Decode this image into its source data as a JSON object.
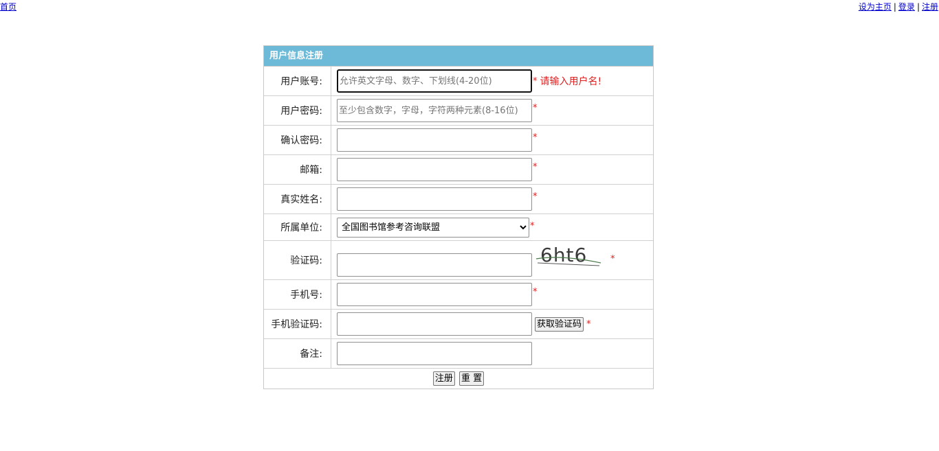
{
  "topbar": {
    "home_link": "首页",
    "set_homepage_link": "设为主页",
    "login_link": "登录",
    "register_link": "注册",
    "separator": "|"
  },
  "form": {
    "title": "用户信息注册",
    "required_mark": "*",
    "fields": {
      "username": {
        "label": "用户账号:",
        "placeholder": "允许英文字母、数字、下划线(4-20位)",
        "value": "",
        "error": "请输入用户名!"
      },
      "password": {
        "label": "用户密码:",
        "placeholder": "至少包含数字，字母，字符两种元素(8-16位)",
        "value": ""
      },
      "confirm_password": {
        "label": "确认密码:",
        "value": ""
      },
      "email": {
        "label": "邮箱:",
        "value": ""
      },
      "real_name": {
        "label": "真实姓名:",
        "value": ""
      },
      "organization": {
        "label": "所属单位:",
        "selected": "全国图书馆参考咨询联盟"
      },
      "captcha": {
        "label": "验证码:",
        "value": "",
        "captcha_text": "6ht6"
      },
      "phone": {
        "label": "手机号:",
        "value": ""
      },
      "sms_code": {
        "label": "手机验证码:",
        "value": "",
        "get_code_button": "获取验证码"
      },
      "remark": {
        "label": "备注:",
        "value": ""
      }
    },
    "submit_button": "注册",
    "reset_button": "重 置"
  },
  "colors": {
    "header_bg": "#6cbad7",
    "required": "#e02020",
    "link": "#0000cc"
  }
}
